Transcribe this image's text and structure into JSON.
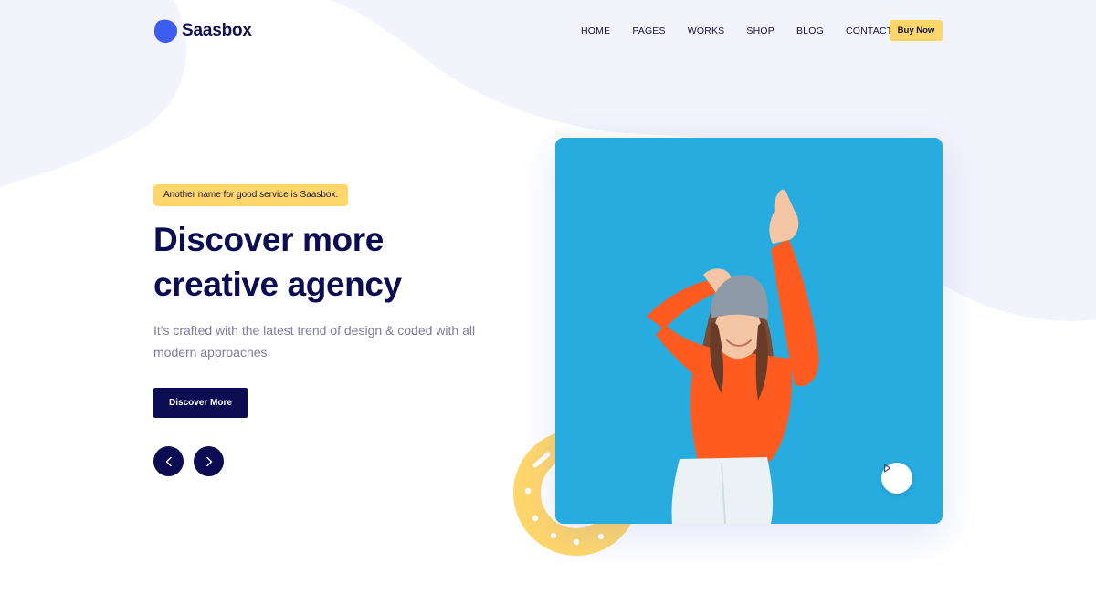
{
  "brand": {
    "name": "Saasbox",
    "accent": "#3d5cf0"
  },
  "nav": {
    "items": [
      "HOME",
      "PAGES",
      "WORKS",
      "SHOP",
      "BLOG",
      "CONTACT"
    ],
    "buy_label": "Buy Now"
  },
  "hero": {
    "badge": "Another name for good service is Saasbox.",
    "title_line1": "Discover more",
    "title_line2": "creative agency",
    "subtitle": "It's crafted with the latest trend of design & coded with all modern approaches.",
    "cta_label": "Discover More",
    "prev_icon": "chevron-left-icon",
    "next_icon": "chevron-right-icon",
    "play_icon": "play-icon"
  },
  "colors": {
    "navy": "#0c0c52",
    "yellow": "#ffd66b",
    "blob": "#f3f3fc",
    "photo_bg": "#28ace0"
  }
}
